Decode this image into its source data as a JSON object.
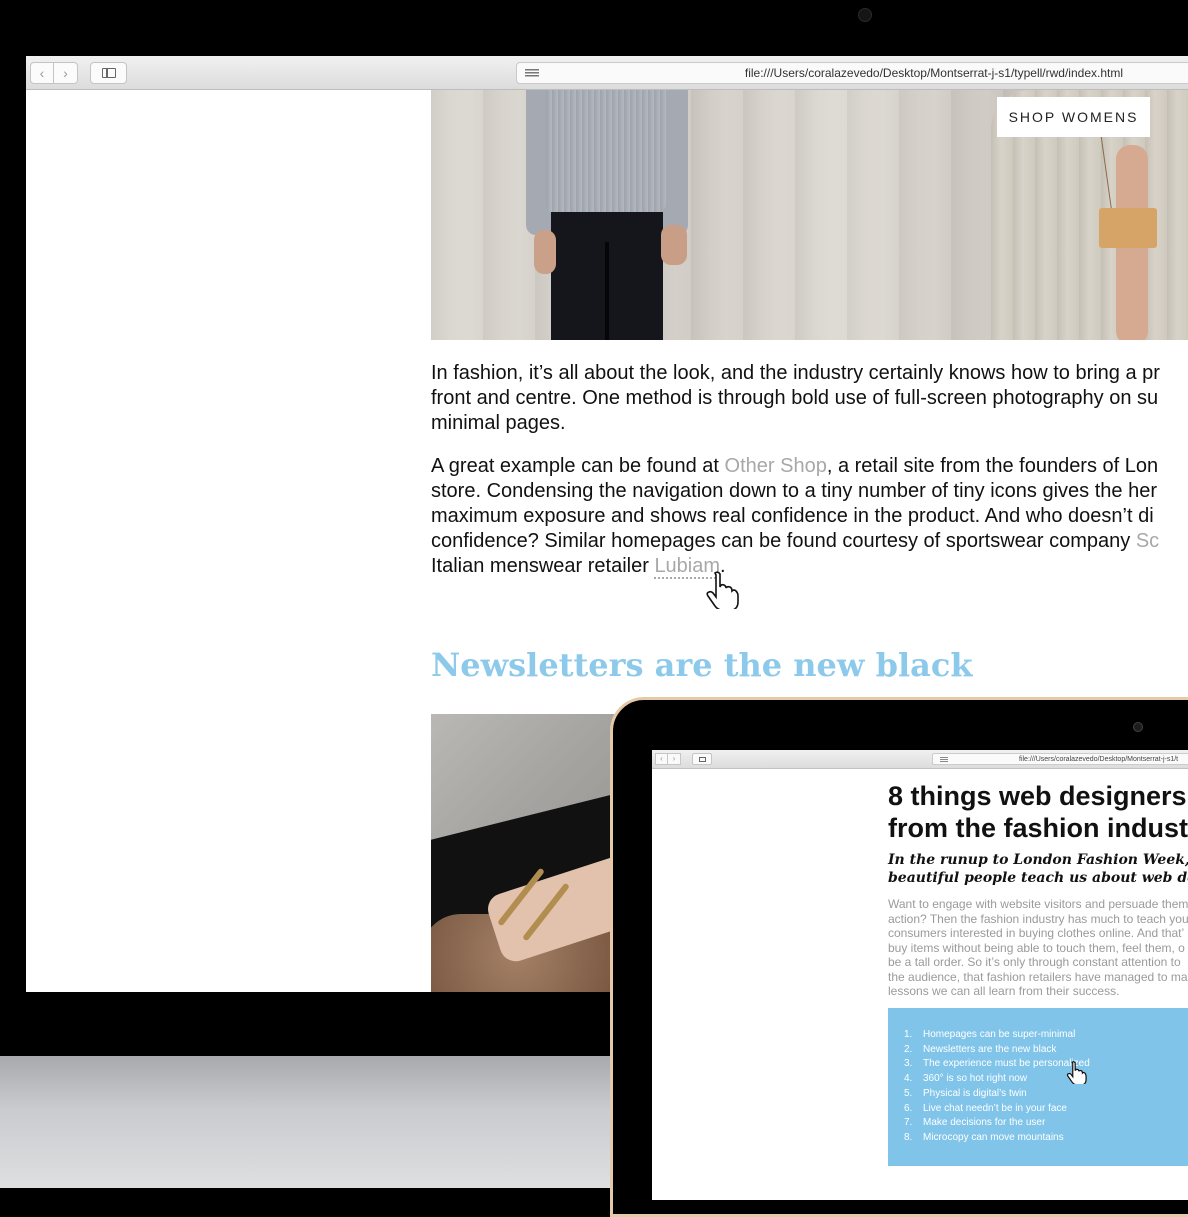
{
  "desktop": {
    "browser": {
      "back_glyph": "‹",
      "forward_glyph": "›",
      "url": "file:///Users/coralazevedo/Desktop/Montserrat-j-s1/typell/rwd/index.html"
    },
    "hero": {
      "shop_button": "SHOP WOMENS"
    },
    "paragraphs": {
      "p1": {
        "lines": [
          "In fashion, it’s all about the look, and the industry certainly knows how to bring a pr",
          "front and centre. One method is through bold use of full-screen photography on su",
          "minimal pages."
        ]
      },
      "p2": {
        "line1_a": "A great example can be found at ",
        "line1_link": "Other Shop",
        "line1_b": ", a retail site from the founders of Lon",
        "line2": "store. Condensing the navigation down to a tiny number of tiny icons gives the her",
        "line3": "maximum exposure and shows real confidence in the product. And who doesn’t di",
        "line4_a": "confidence? Similar homepages can be found courtesy of sportswear company ",
        "line4_link": "Sc",
        "line5_a": "Italian menswear retailer ",
        "line5_link": "Lubiam",
        "line5_b": "."
      }
    },
    "heading": "Newsletters are the new black"
  },
  "device": {
    "browser": {
      "back_glyph": "‹",
      "forward_glyph": "›",
      "url": "file:///Users/coralazevedo/Desktop/Montserrat-j-s1/t"
    },
    "article": {
      "title_lines": [
        "8 things web designers",
        "from the fashion indust"
      ],
      "subtitle_lines": [
        "In the runup to London Fashion Week,",
        "beautiful people teach us about web de"
      ],
      "body_lines": [
        "Want to engage with website visitors and persuade them",
        "action? Then the fashion industry has much to teach you",
        "consumers interested in buying clothes online. And that’",
        "buy items without being able to touch them, feel them, o",
        "be a tall order. So it’s only through constant attention to",
        "the audience, that fashion retailers have managed to ma",
        "lessons we can all learn from their success."
      ],
      "toc": [
        {
          "num": "1.",
          "label": "Homepages can be super-minimal"
        },
        {
          "num": "2.",
          "label": "Newsletters are the new black"
        },
        {
          "num": "3.",
          "label": "The experience must be personalized"
        },
        {
          "num": "4.",
          "label": "360° is so hot right now"
        },
        {
          "num": "5.",
          "label": "Physical is digital’s twin"
        },
        {
          "num": "6.",
          "label": "Live chat needn’t be in your face"
        },
        {
          "num": "7.",
          "label": "Make decisions for the user"
        },
        {
          "num": "8.",
          "label": "Microcopy can move mountains"
        }
      ]
    }
  },
  "colors": {
    "heading_blue": "#8cc9ea",
    "toc_blue": "#80c4ea",
    "link_grey": "#a8a8a8",
    "device_trim": "#e6c9a8"
  }
}
